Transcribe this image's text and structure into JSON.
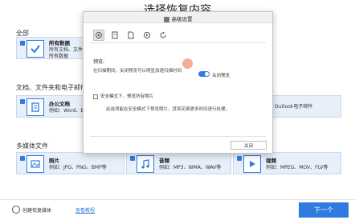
{
  "header": {
    "title": "选择恢复内容"
  },
  "sections": {
    "all": "全部",
    "docs": "文档、文件夹和电子邮件",
    "media": "多媒体文件"
  },
  "cards": {
    "all_data": {
      "title": "所有数据",
      "desc1": "所有文档、文件",
      "desc2": "所有数据"
    },
    "office": {
      "title": "办公文档",
      "desc": "例如：Word、Excel"
    },
    "outlook": {
      "desc": "MS Outlook电子邮件"
    },
    "photo": {
      "title": "照片",
      "desc": "例如：JPG、PNG、BMP等"
    },
    "audio": {
      "title": "音频",
      "desc": "例如：MP3、WMA、WAV等"
    },
    "video": {
      "title": "视频",
      "desc": "例如：MPEG、MOV、FLV等"
    }
  },
  "dialog": {
    "title": "高级设置",
    "tabs": [
      "tab-general-icon",
      "tab-document-icon",
      "tab-file-icon",
      "tab-recover-icon",
      "tab-refresh-icon"
    ],
    "preview_label": "预览:",
    "preview_desc": "在扫描期间，关闭预览可以明显加速扫描时间",
    "toggle_label": "关闭预览",
    "toggle_state": "on",
    "safe_mode_label": "安全模式下，预览所有照片",
    "safe_mode_note": "此选项能在安全模式下预览照片，其将花费更多时间进行处理。",
    "close_label": "关闭"
  },
  "footer": {
    "create_label": "创建恢复媒体",
    "demo_label": "查看教程",
    "next_label": "下一个"
  },
  "colors": {
    "accent": "#2f7be0",
    "card_bg": "#e6effa"
  }
}
